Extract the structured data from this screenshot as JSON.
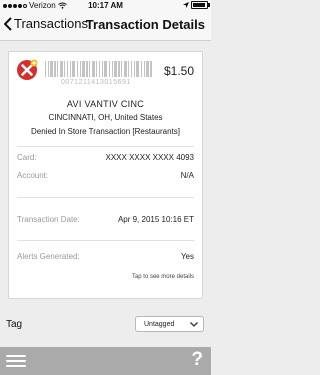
{
  "status_bar": {
    "carrier": "Verizon",
    "time": "10:17 AM",
    "battery_level": 0.9
  },
  "nav": {
    "back_label": "Transactions",
    "title": "Transaction Details"
  },
  "transaction": {
    "status_icon": "declined-x-icon",
    "barcode_text": "0071211413015691",
    "amount": "$1.50",
    "merchant_name": "AVI VANTIV CINC",
    "merchant_location": "CINCINNATI, OH, United States",
    "transaction_type": "Denied In Store Transaction [Restaurants]",
    "fields": [
      {
        "label": "Card:",
        "value": "XXXX XXXX XXXX 4093"
      },
      {
        "label": "Account:",
        "value": "N/A"
      },
      {
        "label": "Transaction Date:",
        "value": "Apr 9, 2015 10:16 ET"
      },
      {
        "label": "Alerts Generated:",
        "value": "Yes"
      }
    ],
    "more_details": "Tap to see more details"
  },
  "tag": {
    "label": "Tag",
    "selected": "Untagged"
  },
  "bottom_bar": {
    "menu_icon": "hamburger-menu-icon",
    "help_label": "?"
  },
  "colors": {
    "declined_red": "#d32f2f",
    "accent_yellow": "#f5b400",
    "bottom_bar": "#aaaaaa"
  }
}
